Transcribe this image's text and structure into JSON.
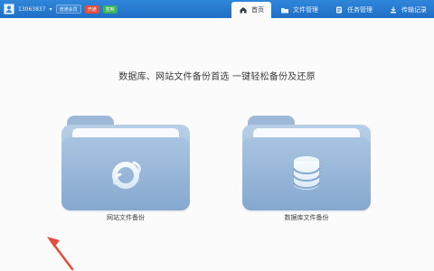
{
  "topbar": {
    "user_name": "13063837",
    "level": "普通会员",
    "badge_red": "开通",
    "badge_green": "签到"
  },
  "nav": {
    "tabs": [
      {
        "label": "首页",
        "active": true,
        "icon": "home-icon"
      },
      {
        "label": "文件管理",
        "active": false,
        "icon": "folder-icon"
      },
      {
        "label": "任务管理",
        "active": false,
        "icon": "task-icon"
      },
      {
        "label": "传输记录",
        "active": false,
        "icon": "transfer-icon"
      }
    ]
  },
  "main": {
    "tagline": "数据库、网站文件备份首选  一键轻松备份及还原",
    "cards": [
      {
        "label": "网站文件备份",
        "icon": "browser-e-icon"
      },
      {
        "label": "数据库文件备份",
        "icon": "database-icon"
      }
    ]
  },
  "colors": {
    "topbar": "#1f6fc6",
    "folder": "#9bb8d6",
    "arrow": "#e74c3c"
  }
}
